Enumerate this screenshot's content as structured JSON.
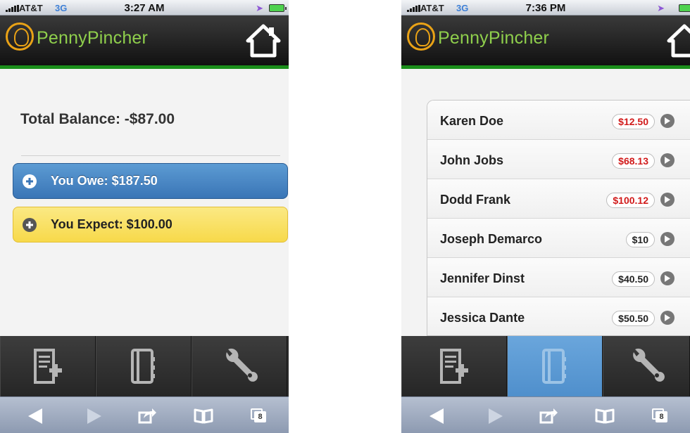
{
  "screens": [
    {
      "status": {
        "carrier": "AT&T",
        "network": "3G",
        "time": "3:27 AM"
      },
      "app_title": "PennyPincher",
      "total_balance": "Total Balance: -$87.00",
      "you_owe": "You Owe: $187.50",
      "you_expect": "You Expect: $100.00"
    },
    {
      "status": {
        "carrier": "AT&T",
        "network": "3G",
        "time": "7:36 PM"
      },
      "app_title": "PennyPincher",
      "contacts": [
        {
          "name": "Karen Doe",
          "amount": "$12.50",
          "kind": "owe"
        },
        {
          "name": "John Jobs",
          "amount": "$68.13",
          "kind": "owe"
        },
        {
          "name": "Dodd Frank",
          "amount": "$100.12",
          "kind": "owe"
        },
        {
          "name": "Joseph Demarco",
          "amount": "$10",
          "kind": "expect"
        },
        {
          "name": "Jennifer Dinst",
          "amount": "$40.50",
          "kind": "expect"
        },
        {
          "name": "Jessica Dante",
          "amount": "$50.50",
          "kind": "expect"
        }
      ]
    }
  ],
  "tabs": [
    "add-transaction-icon",
    "contacts-book-icon",
    "settings-wrench-icon"
  ],
  "browser": {
    "tab_count": "8"
  },
  "colors": {
    "owe_amount": "#d11a1a",
    "header_bar": "#1b8e1b",
    "logo_green": "#8fcf4c",
    "logo_orange": "#e9a216",
    "active_tab": "#5b9ad5"
  }
}
